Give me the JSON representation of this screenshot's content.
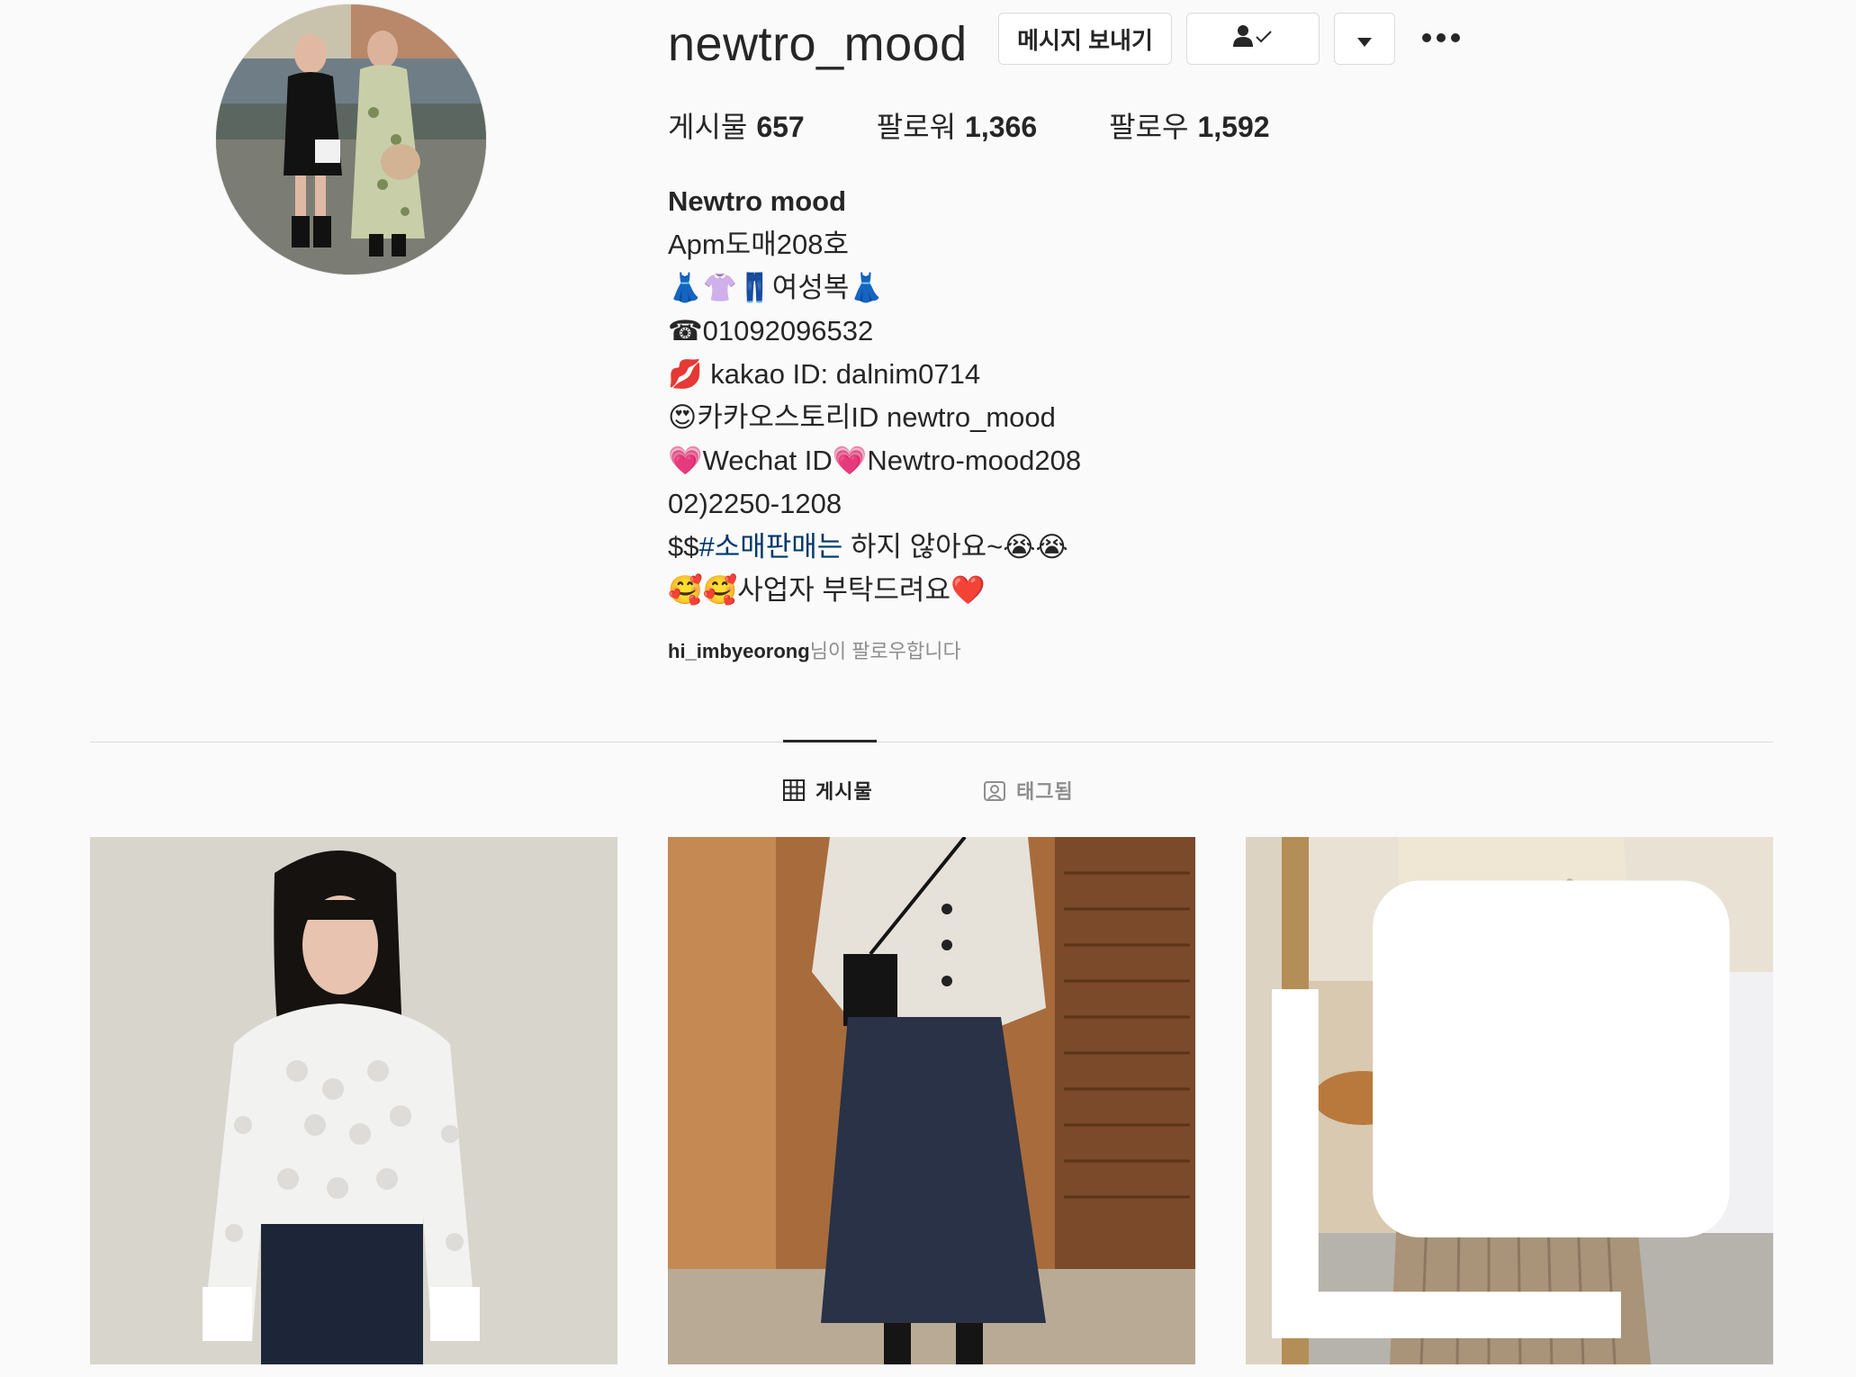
{
  "profile": {
    "username": "newtro_mood",
    "avatar_icon": "profile-photo",
    "buttons": {
      "message": "메시지 보내기",
      "following_icon": "user-check-icon",
      "dropdown_icon": "caret-down-icon",
      "more_icon": "more-horizontal-icon"
    },
    "stats": {
      "posts_label": "게시물",
      "posts_count": "657",
      "followers_label": "팔로워",
      "followers_count": "1,366",
      "following_label": "팔로우",
      "following_count": "1,592"
    },
    "bio": {
      "full_name": "Newtro mood",
      "lines": [
        "Apm도매208호",
        "👗👚👖여성복👗",
        "☎01092096532",
        "💋 kakao ID: dalnim0714",
        "😍카카오스토리ID newtro_mood",
        "💗Wechat ID💗Newtro-mood208",
        "02)2250-1208"
      ],
      "retail_prefix": "$$",
      "retail_hashtag": "#소매판매는",
      "retail_suffix": " 하지 않아요~😭😭",
      "last_line": "🥰🥰사업자 부탁드려요❤️"
    },
    "followed_by": {
      "user": "hi_imbyeorong",
      "suffix": "님이 팔로우합니다"
    }
  },
  "tabs": [
    {
      "label": "게시물",
      "icon": "grid-icon",
      "active": true
    },
    {
      "label": "태그됨",
      "icon": "tagged-icon",
      "active": false
    }
  ],
  "posts": [
    {
      "kind": "photo",
      "description_icon": "photo"
    },
    {
      "kind": "photo",
      "description_icon": "photo"
    },
    {
      "kind": "carousel",
      "badge_icon": "multiple-photos-icon"
    }
  ],
  "colors": {
    "background": "#fafafa",
    "text": "#262626",
    "muted": "#8e8e8e",
    "border": "#dbdbdb",
    "link": "#00376b"
  }
}
